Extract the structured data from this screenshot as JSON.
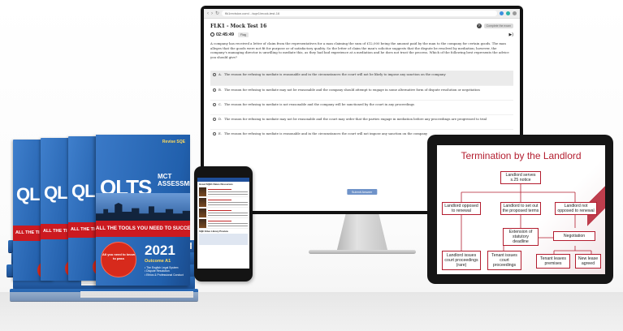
{
  "browser": {
    "url": "flk1revision.com/.../sqe1/mock-test-16"
  },
  "exam": {
    "title": "FLK1 - Mock Test 16",
    "header_button": "Complete the exam",
    "timer": "02:45:49",
    "flag_label": "Flag",
    "question": "A company has received a letter of claim from the representatives for a man claiming the sum of £12,000 being the amount paid by the man to the company for certain goods. The man alleges that the goods were not fit for purpose or of satisfactory quality. So the letter of claim the man's solicitor suggests that the dispute be resolved by mediation; however, the company's managing director is unwilling to mediate this, as they had bad experience at a mediation and he does not trust the process. Which of the following best represents the advice you should give?",
    "options": [
      {
        "letter": "A.",
        "text": "The reason for refusing to mediate is reasonable and in the circumstances the court will not be likely to impose any sanction on the company"
      },
      {
        "letter": "B.",
        "text": "The reason for refusing to mediate may not be reasonable and the company should attempt to engage in some alternative form of dispute resolution or negotiation"
      },
      {
        "letter": "C.",
        "text": "The reason for refusing to mediate is not reasonable and the company will be sanctioned by the court in any proceedings"
      },
      {
        "letter": "D.",
        "text": "The reason for refusing to mediate may not be reasonable and the court may order that the parties engage in mediation before any proceedings are progressed to trial"
      },
      {
        "letter": "E.",
        "text": "The reason for refusing to mediate is reasonable and in the circumstances the court will not impose any sanction on the company"
      }
    ],
    "submit_label": "Submit Answer"
  },
  "book": {
    "logo": "Revise SQE",
    "title": "QLTS",
    "sub1": "MCT",
    "sub2": "ASSESSMENT",
    "band": "ALL THE TOOLS YOU NEED TO SUCCEED",
    "year": "2021",
    "outcome": "Outcome A1",
    "bullets": [
      "• The English Legal System",
      "• Dispute Resolution",
      "• Ethics & Professional Conduct"
    ],
    "badge": "All you need to know to pass",
    "spine_titles": [
      "QL",
      "QL",
      "QL"
    ],
    "spine_band": "ALL THE TI"
  },
  "phone": {
    "header": "Great SQE1 Dates Resources",
    "footer_title": "SQE Video Library Preview"
  },
  "slide": {
    "title": "Termination by the Landlord",
    "nodes": {
      "root": "Landlord serves s.25 notice",
      "opposed": "Landlord opposed to renewal",
      "set_out": "Landlord to set out the proposed terms",
      "not_opposed": "Landlord not opposed to renewal",
      "extension": "Extension of statutory deadline",
      "negotiation": "Negotiation",
      "landlord_issues": "Landlord issues court proceedings (rare)",
      "tenant_issues": "Tenant issues court proceedings",
      "tenant_leaves": "Tenant leaves premises",
      "new_lease": "New lease agreed"
    }
  },
  "colors": {
    "book_blue": "#2461ad",
    "band_red": "#cc1a20",
    "slide_red": "#b31d2f",
    "submit_blue": "#6f93c9"
  }
}
